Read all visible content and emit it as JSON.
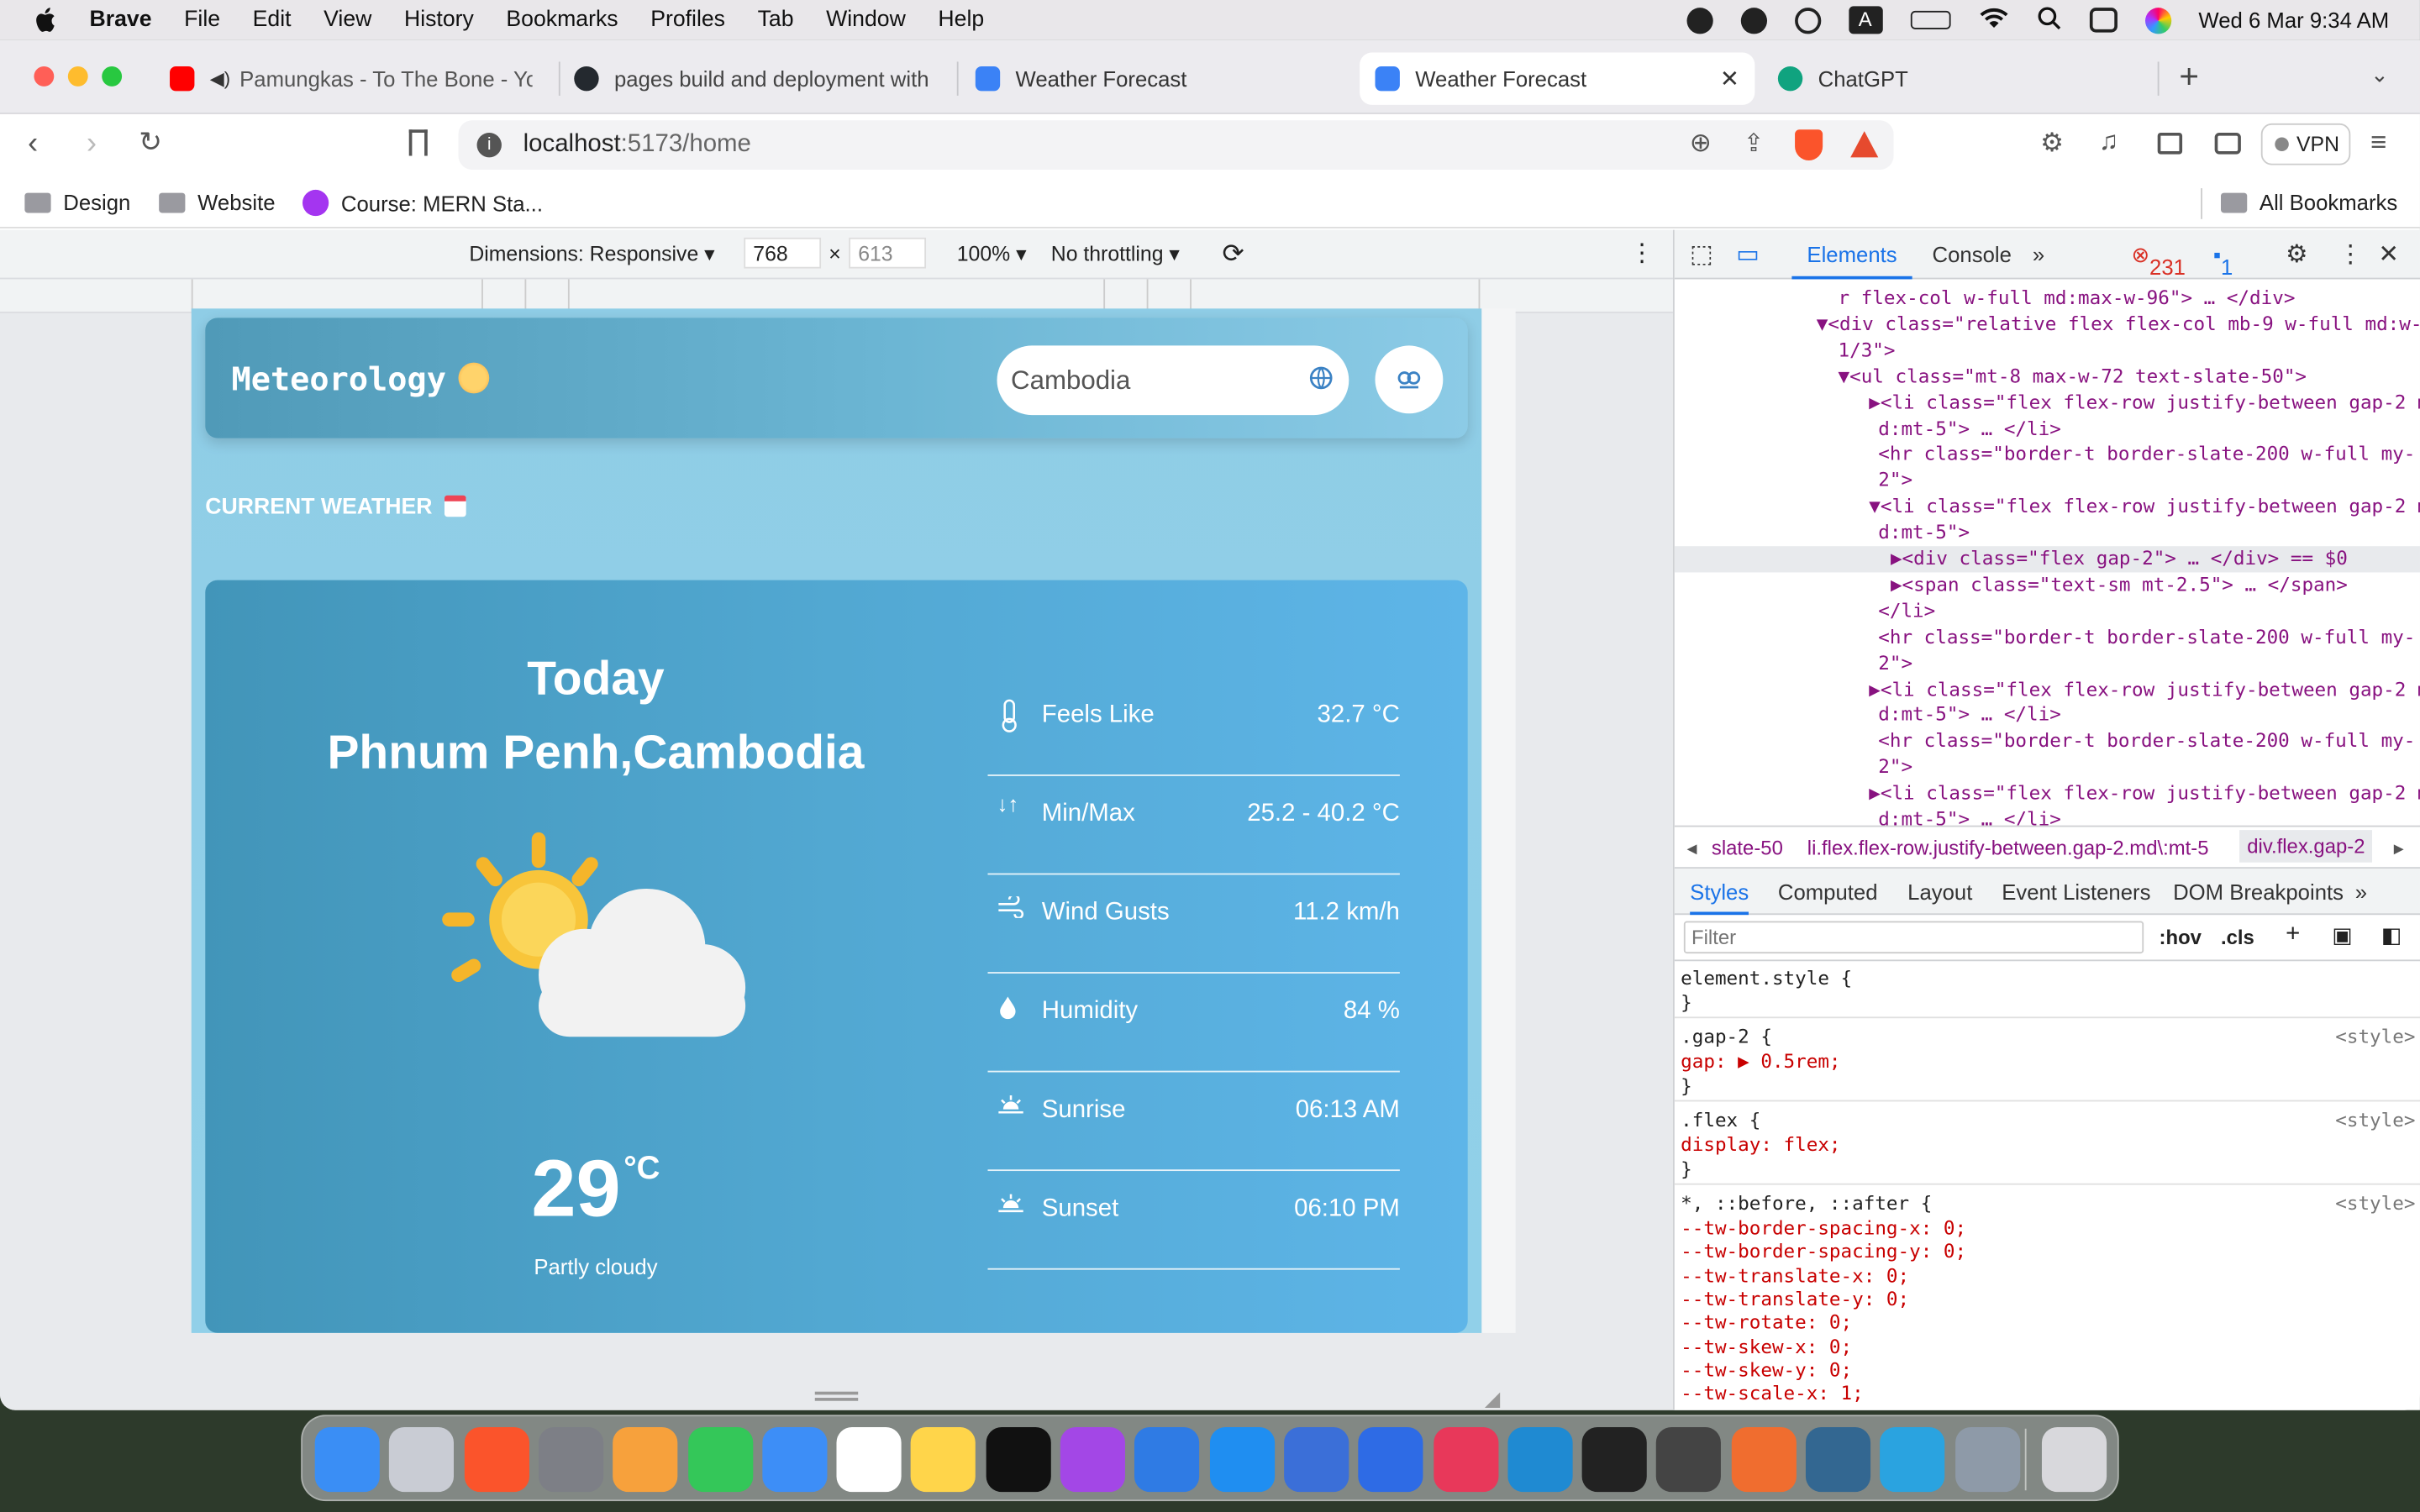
{
  "menubar": {
    "app_name": "Brave",
    "items": [
      "File",
      "Edit",
      "View",
      "History",
      "Bookmarks",
      "Profiles",
      "Tab",
      "Window",
      "Help"
    ],
    "clock": "Wed 6 Mar  9:34 AM"
  },
  "tabs": [
    {
      "title": "Pamungkas - To The Bone - Yo",
      "fav_color": "#ff0000"
    },
    {
      "title": "pages build and deployment with",
      "fav_color": "#24292f"
    },
    {
      "title": "Weather Forecast",
      "fav_color": "#3b82f6"
    },
    {
      "title": "Weather Forecast",
      "fav_color": "#3b82f6"
    },
    {
      "title": "ChatGPT",
      "fav_color": "#10a37f"
    }
  ],
  "url": {
    "host": "localhost",
    "path": ":5173/home"
  },
  "vpn_label": "VPN",
  "bookmarks": {
    "items": [
      "Design",
      "Website",
      "Course: MERN Sta..."
    ],
    "all": "All Bookmarks"
  },
  "device_toolbar": {
    "dimensions": "Dimensions: Responsive",
    "width": "768",
    "times": "×",
    "height": "613",
    "zoom": "100%",
    "throttling": "No throttling"
  },
  "app": {
    "logo": "Meteorology",
    "search_value": "Cambodia",
    "section_title": "CURRENT WEATHER",
    "today": "Today",
    "location": "Phnum Penh,Cambodia",
    "temperature": "29",
    "unit": "°C",
    "condition": "Partly cloudy",
    "metrics": [
      {
        "label": "Feels Like",
        "value": "32.7 °C",
        "icon": "thermometer-icon"
      },
      {
        "label": "Min/Max",
        "value": "25.2 - 40.2 °C",
        "icon": "arrows-updown-icon"
      },
      {
        "label": "Wind Gusts",
        "value": "11.2 km/h",
        "icon": "wind-icon"
      },
      {
        "label": "Humidity",
        "value": "84 %",
        "icon": "droplet-icon"
      },
      {
        "label": "Sunrise",
        "value": "06:13 AM",
        "icon": "sunrise-icon"
      },
      {
        "label": "Sunset",
        "value": "06:10 PM",
        "icon": "sunset-icon"
      }
    ]
  },
  "devtools": {
    "tabs": [
      "Elements",
      "Console"
    ],
    "errors": "231",
    "messages": "1",
    "code_lines": [
      "r flex-col w-full md:max-w-96\"> … </div>",
      "▼<div class=\"relative flex flex-col mb-9 w-full md:w-",
      "1/3\">",
      "▼<ul class=\"mt-8 max-w-72 text-slate-50\">",
      "▶<li class=\"flex flex-row justify-between gap-2 m",
      "d:mt-5\"> … </li>",
      "<hr class=\"border-t border-slate-200 w-full my-",
      "2\">",
      "▼<li class=\"flex flex-row justify-between gap-2 m",
      "d:mt-5\">",
      "▶<div class=\"flex gap-2\"> … </div>  == $0",
      "▶<span class=\"text-sm mt-2.5\"> … </span>",
      "</li>",
      "<hr class=\"border-t border-slate-200 w-full my-",
      "2\">",
      "▶<li class=\"flex flex-row justify-between gap-2 m",
      "d:mt-5\"> … </li>",
      "<hr class=\"border-t border-slate-200 w-full my-",
      "2\">",
      "▶<li class=\"flex flex-row justify-between gap-2 m",
      "d:mt-5\"> … </li>"
    ],
    "breadcrumbs": [
      "slate-50",
      "li.flex.flex-row.justify-between.gap-2.md\\:mt-5",
      "div.flex.gap-2"
    ],
    "style_tabs": [
      "Styles",
      "Computed",
      "Layout",
      "Event Listeners",
      "DOM Breakpoints"
    ],
    "filter_placeholder": "Filter",
    "hov": ":hov",
    "cls": ".cls",
    "style_lines": [
      "element.style {",
      "}",
      ".gap-2 {",
      "  gap: ▶ 0.5rem;",
      "}",
      ".flex {",
      "  display: flex;",
      "}",
      "*, ::before, ::after {",
      "  --tw-border-spacing-x: 0;",
      "  --tw-border-spacing-y: 0;",
      "  --tw-translate-x: 0;",
      "  --tw-translate-y: 0;",
      "  --tw-rotate: 0;",
      "  --tw-skew-x: 0;",
      "  --tw-skew-y: 0;",
      "  --tw-scale-x: 1;"
    ],
    "style_source": "<style>"
  }
}
